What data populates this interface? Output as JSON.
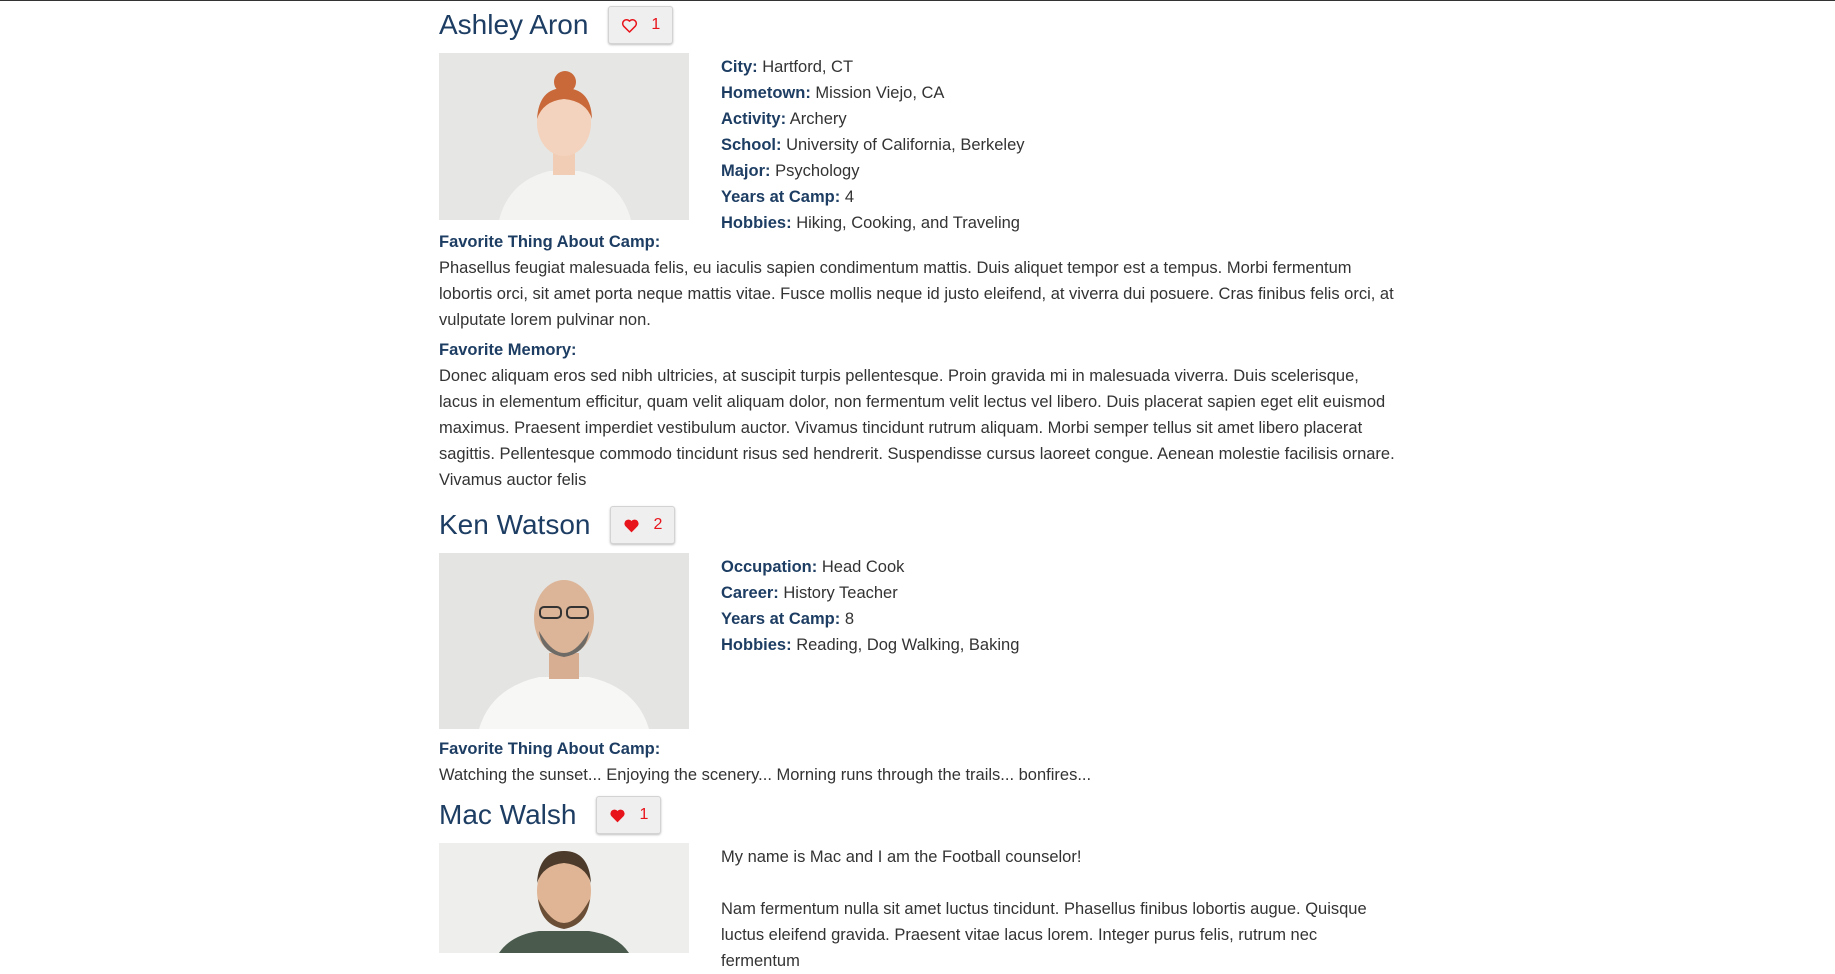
{
  "colors": {
    "name": "#1d3d63",
    "label": "#1d3d63",
    "heart": "#e8141b",
    "button_bg": "#efefef"
  },
  "profiles": [
    {
      "name": "Ashley Aron",
      "likes": "1",
      "liked": false,
      "heart_icon": "heart-outline-icon",
      "details": [
        {
          "label": "City:",
          "value": "Hartford, CT"
        },
        {
          "label": "Hometown:",
          "value": "Mission Viejo, CA"
        },
        {
          "label": "Activity:",
          "value": "Archery"
        },
        {
          "label": "School:",
          "value": "University of California, Berkeley"
        },
        {
          "label": "Major:",
          "value": "Psychology"
        },
        {
          "label": "Years at Camp:",
          "value": "4"
        },
        {
          "label": "Hobbies:",
          "value": "Hiking, Cooking, and Traveling"
        }
      ],
      "favorite_thing_label": "Favorite Thing About Camp:",
      "favorite_thing_text": "Phasellus feugiat malesuada felis, eu iaculis sapien condimentum mattis. Duis aliquet tempor est a tempus. Morbi fermentum lobortis orci, sit amet porta neque mattis vitae. Fusce mollis neque id justo eleifend, at viverra dui posuere. Cras finibus felis orci, at vulputate lorem pulvinar non.",
      "favorite_memory_label": "Favorite Memory:",
      "favorite_memory_text": "Donec aliquam eros sed nibh ultricies, at suscipit turpis pellentesque. Proin gravida mi in malesuada viverra. Duis scelerisque, lacus in elementum efficitur, quam velit aliquam dolor, non fermentum velit lectus vel libero. Duis placerat sapien eget elit euismod maximus. Praesent imperdiet vestibulum auctor. Vivamus tincidunt rutrum aliquam. Morbi semper tellus sit amet libero placerat sagittis. Pellentesque commodo tincidunt risus sed hendrerit. Suspendisse cursus laoreet congue. Aenean molestie facilisis ornare. Vivamus auctor felis"
    },
    {
      "name": "Ken Watson",
      "likes": "2",
      "liked": true,
      "heart_icon": "heart-filled-icon",
      "details": [
        {
          "label": "Occupation:",
          "value": "Head Cook"
        },
        {
          "label": "Career:",
          "value": "History Teacher"
        },
        {
          "label": "Years at Camp:",
          "value": "8"
        },
        {
          "label": "Hobbies:",
          "value": "Reading, Dog Walking, Baking"
        }
      ],
      "favorite_thing_label": "Favorite Thing About Camp:",
      "favorite_thing_text": "Watching the sunset... Enjoying the scenery... Morning runs through the trails... bonfires..."
    },
    {
      "name": "Mac Walsh",
      "likes": "1",
      "liked": true,
      "heart_icon": "heart-filled-icon",
      "intro": "My name is Mac and I am the Football counselor!",
      "bio": "Nam fermentum nulla sit amet luctus tincidunt. Phasellus finibus lobortis augue. Quisque luctus eleifend gravida. Praesent vitae lacus lorem. Integer purus felis, rutrum nec fermentum"
    }
  ]
}
